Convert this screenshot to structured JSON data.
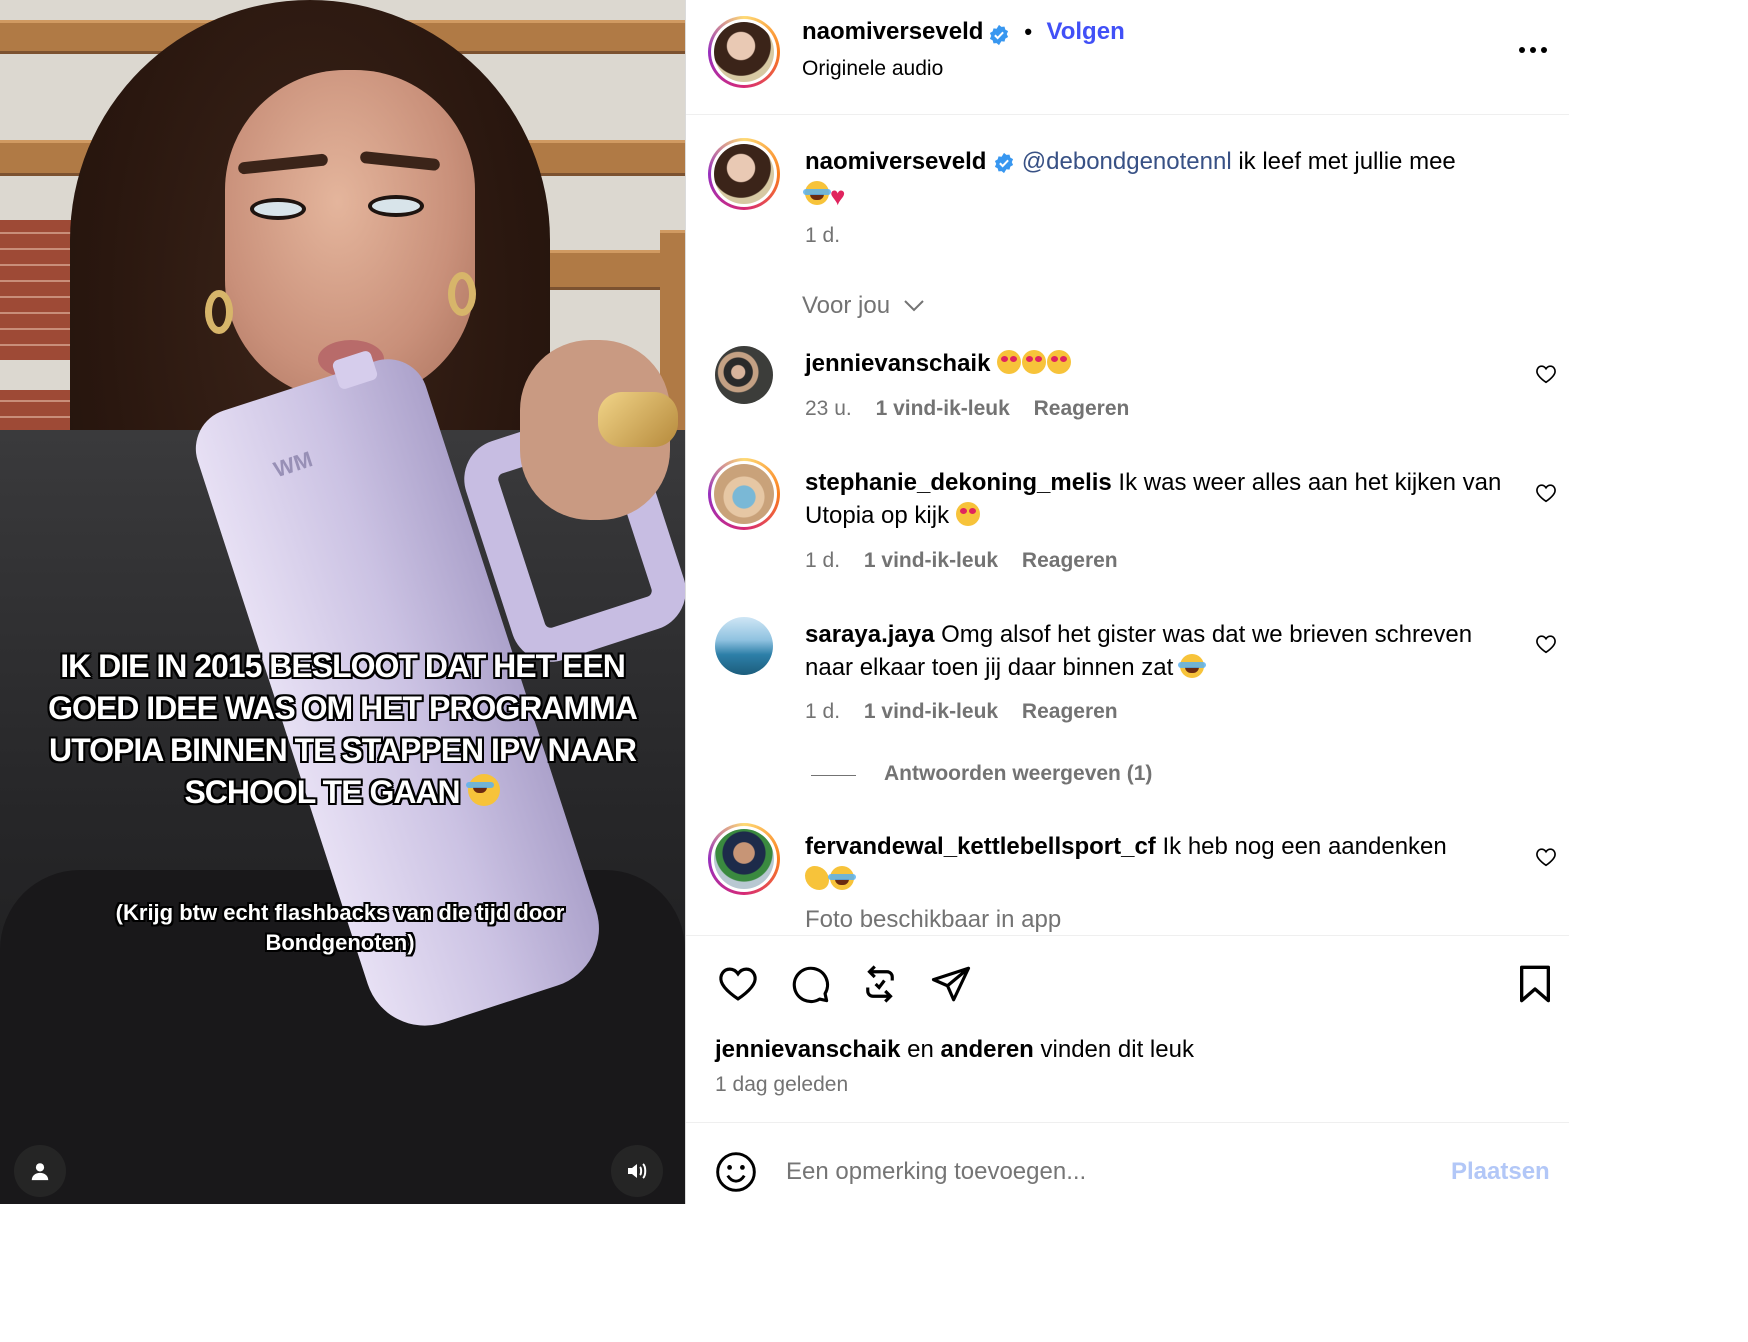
{
  "post": {
    "author": "naomiverseveld",
    "follow_label": "Volgen",
    "audio_label": "Originele audio",
    "dot": "•"
  },
  "caption": {
    "author": "naomiverseveld",
    "mention": "@debondgenotennl",
    "text": " ik leef met jullie mee",
    "time": "1 d."
  },
  "sort_label": "Voor jou",
  "comments": [
    {
      "user": "jennievanschaik",
      "text": "",
      "emoji": [
        "eyes",
        "eyes",
        "eyes"
      ],
      "time": "23 u.",
      "likes": "1 vind-ik-leuk",
      "reply": "Reageren"
    },
    {
      "user": "stephanie_dekoning_melis",
      "text": " Ik was weer alles aan het kijken van Utopia op kijk",
      "emoji": [
        "eyes"
      ],
      "time": "1 d.",
      "likes": "1 vind-ik-leuk",
      "reply": "Reageren"
    },
    {
      "user": "saraya.jaya",
      "text": " Omg alsof het gister was dat we brieven schreven naar elkaar toen jij daar binnen zat",
      "emoji": [
        "laugh"
      ],
      "time": "1 d.",
      "likes": "1 vind-ik-leuk",
      "reply": "Reageren",
      "view_replies": "Antwoorden weergeven (1)"
    },
    {
      "user": "fervandewal_kettlebellsport_cf",
      "text": " Ik heb nog een aandenken",
      "emoji": [
        "muscle",
        "laugh"
      ],
      "note": "Foto beschikbaar in app"
    }
  ],
  "likes_summary": {
    "user": "jennievanschaik",
    "mid": " en ",
    "others": "anderen",
    "tail": " vinden dit leuk",
    "time": "1 dag geleden"
  },
  "comment_box": {
    "placeholder": "Een opmerking toevoegen...",
    "post_label": "Plaatsen"
  },
  "media_caption": {
    "main": "IK DIE IN 2015 BESLOOT DAT HET EEN GOED IDEE WAS OM HET PROGRAMMA UTOPIA BINNEN TE STAPPEN IPV NAAR SCHOOL TE GAAN",
    "sub": "(Krijg btw echt flashbacks van die tijd door Bondgenoten)",
    "bottle_logo": "WM"
  },
  "icons": {
    "verified": "verified-badge-icon",
    "more": "more-options-icon",
    "like": "heart-icon",
    "comment": "comment-icon",
    "repost": "repost-icon",
    "share": "share-icon",
    "save": "bookmark-icon",
    "emoji": "emoji-icon",
    "user": "user-tag-icon",
    "sound": "speaker-icon",
    "chevron": "chevron-down-icon"
  },
  "colors": {
    "accent": "#4150f7",
    "link": "#385185",
    "secondary": "#737373",
    "post_button": "#b2c7f7",
    "verified": "#3897f0"
  }
}
